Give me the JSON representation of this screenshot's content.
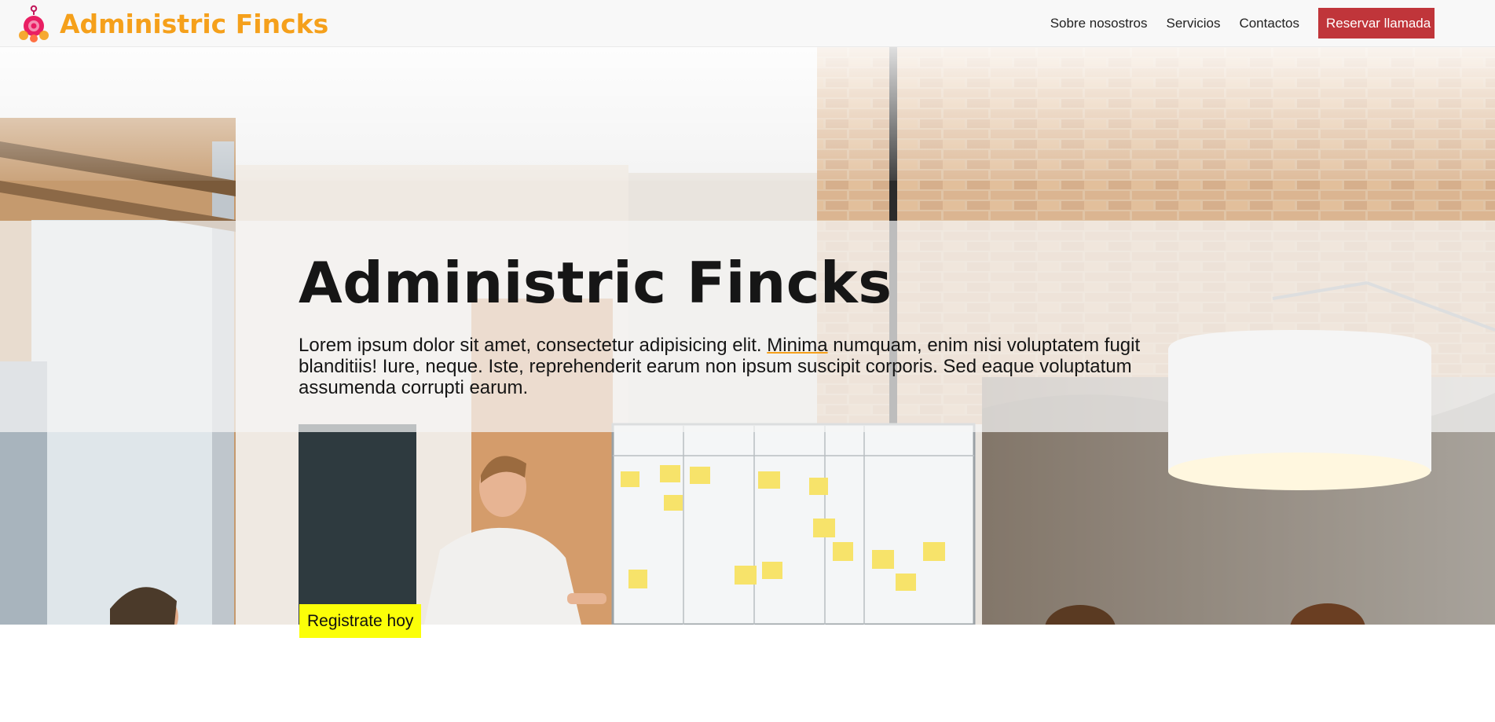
{
  "navbar": {
    "brand": "Administric Fincks",
    "links": [
      "Sobre nosostros",
      "Servicios",
      "Contactos"
    ],
    "cta": "Reservar llamada"
  },
  "hero": {
    "title": "Administric Fincks",
    "text_before": "Lorem ipsum dolor sit amet, consectetur adipisicing elit. ",
    "highlight": "Minima",
    "text_after": " numquam, enim nisi voluptatem fugit blanditiis! Iure, neque. Iste, reprehenderit earum non ipsum suscipit corporis. Sed eaque voluptatum assumenda corrupti earum.",
    "background_image": "office meeting photo with brick wall, whiteboard with sticky notes and presenter"
  },
  "register_button": "Registrate hoy",
  "colors": {
    "brand": "#f5a01b",
    "cta": "#c0353a",
    "register": "#fbff08",
    "navbar_bg": "#f8f8f8"
  },
  "icons": {
    "logo": "brand-logo-icon"
  }
}
